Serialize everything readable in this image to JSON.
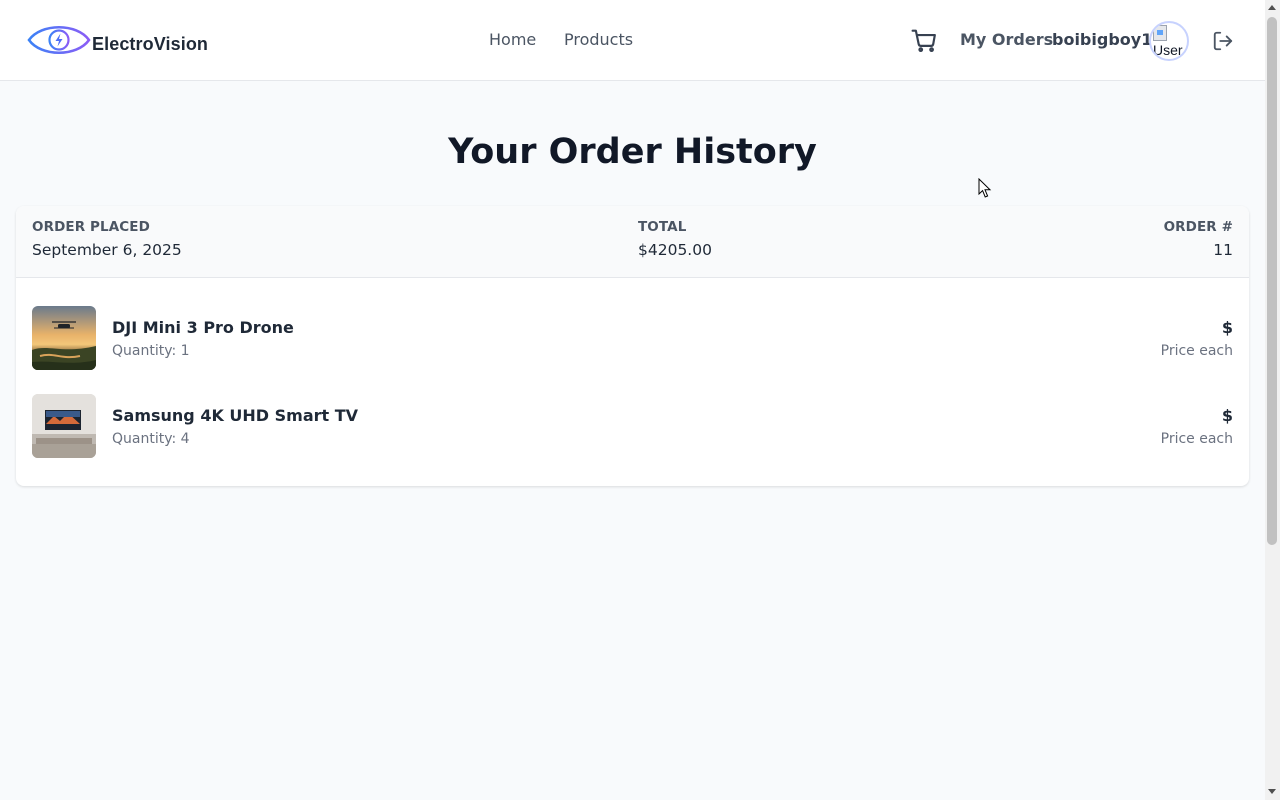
{
  "header": {
    "brand": "ElectroVision",
    "nav": {
      "home": "Home",
      "products": "Products"
    },
    "my_orders": "My Orders",
    "username": "boibigboy1",
    "avatar_alt": "User"
  },
  "page": {
    "title": "Your Order History"
  },
  "order": {
    "placed_label": "ORDER PLACED",
    "placed_value": "September 6, 2025",
    "total_label": "TOTAL",
    "total_value": "$4205.00",
    "number_label": "ORDER #",
    "number_value": "11",
    "items": [
      {
        "name": "DJI Mini 3 Pro Drone",
        "quantity": "Quantity: 1",
        "price": "$",
        "price_note": "Price each"
      },
      {
        "name": "Samsung 4K UHD Smart TV",
        "quantity": "Quantity: 4",
        "price": "$",
        "price_note": "Price each"
      }
    ]
  },
  "icons": {
    "logo": "eye-lightning-logo",
    "cart": "shopping-cart-icon",
    "logout": "logout-icon"
  },
  "colors": {
    "brand_gradient_start": "#3b82f6",
    "brand_gradient_end": "#8b5cf6",
    "page_background": "#f8fafc"
  }
}
